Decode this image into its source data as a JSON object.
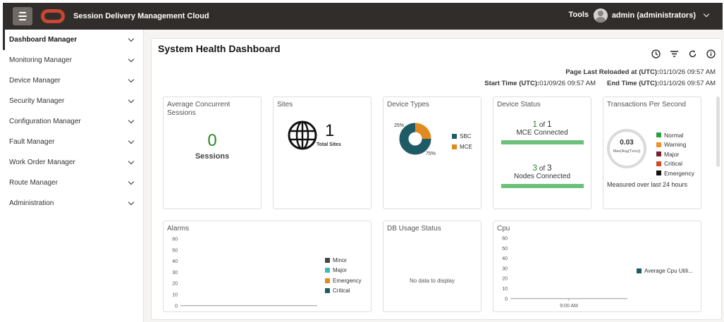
{
  "header": {
    "app_title": "Session Delivery Management Cloud",
    "tools_label": "Tools",
    "user_label": "admin (administrators)"
  },
  "sidebar": {
    "items": [
      {
        "label": "Dashboard Manager"
      },
      {
        "label": "Monitoring Manager"
      },
      {
        "label": "Device Manager"
      },
      {
        "label": "Security Manager"
      },
      {
        "label": "Configuration Manager"
      },
      {
        "label": "Fault Manager"
      },
      {
        "label": "Work Order Manager"
      },
      {
        "label": "Route Manager"
      },
      {
        "label": "Administration"
      }
    ]
  },
  "dashboard": {
    "title": "System Health Dashboard",
    "reload_label": "Page Last Reloaded at (UTC):",
    "reload_value": "01/10/26 09:57 AM",
    "start_label": "Start Time (UTC):",
    "start_value": "01/09/26 09:57 AM",
    "end_label": "End Time (UTC):",
    "end_value": "01/10/26 09:57 AM"
  },
  "cards": {
    "sessions": {
      "title": "Average Concurrent Sessions",
      "value": "0",
      "unit": "Sessions"
    },
    "sites": {
      "title": "Sites",
      "value": "1",
      "unit": "Total Sites"
    },
    "device_types": {
      "title": "Device Types",
      "slices": [
        {
          "name": "SBC",
          "percent": 75,
          "label": "75%",
          "color": "#1e5b66"
        },
        {
          "name": "MCE",
          "percent": 25,
          "label": "25%",
          "color": "#e08a1f"
        }
      ]
    },
    "device_status": {
      "title": "Device Status",
      "mce_count": "1",
      "mce_of": "of",
      "mce_total": "1",
      "mce_label": "MCE Connected",
      "mce_fraction": 1,
      "nodes_count": "3",
      "nodes_of": "of",
      "nodes_total": "3",
      "nodes_label": "Nodes Connected",
      "nodes_fraction": 1
    },
    "tps": {
      "title": "Transactions Per Second",
      "value": "0.03",
      "sub": "Max(Avg(Txns))",
      "footer": "Measured over last 24 hours",
      "legend": [
        {
          "name": "Normal",
          "color": "#2e9e44"
        },
        {
          "name": "Warning",
          "color": "#f0902a"
        },
        {
          "name": "Major",
          "color": "#7a1f2b"
        },
        {
          "name": "Critical",
          "color": "#d04a27"
        },
        {
          "name": "Emergency",
          "color": "#111111"
        }
      ]
    },
    "alarms": {
      "title": "Alarms",
      "legend": [
        {
          "name": "Minor",
          "color": "#4a4441"
        },
        {
          "name": "Major",
          "color": "#3fbab0"
        },
        {
          "name": "Emergency",
          "color": "#e08a1f"
        },
        {
          "name": "Critical",
          "color": "#1e5b66"
        }
      ]
    },
    "db_usage": {
      "title": "DB Usage Status",
      "empty": "No data to display"
    },
    "cpu": {
      "title": "Cpu",
      "legend": [
        {
          "name": "Average Cpu Utili...",
          "color": "#1e5b66"
        }
      ]
    }
  },
  "chart_data": [
    {
      "type": "pie",
      "categories": [
        "SBC",
        "MCE"
      ],
      "values": [
        75,
        25
      ],
      "title": "Device Types"
    },
    {
      "type": "bar",
      "title": "Alarms",
      "ylim": [
        0,
        60
      ],
      "yticks": [
        "60",
        "50",
        "40",
        "30",
        "20",
        "10",
        "0"
      ],
      "series": [
        {
          "name": "Minor",
          "values": []
        },
        {
          "name": "Major",
          "values": []
        },
        {
          "name": "Emergency",
          "values": []
        },
        {
          "name": "Critical",
          "values": []
        }
      ]
    },
    {
      "type": "line",
      "title": "Cpu",
      "ylim": [
        0,
        60
      ],
      "yticks": [
        "60",
        "50",
        "40",
        "30",
        "20",
        "10",
        "0"
      ],
      "xticks": [
        "9:00 AM"
      ],
      "series": [
        {
          "name": "Average Cpu Utili...",
          "values": []
        }
      ]
    }
  ]
}
